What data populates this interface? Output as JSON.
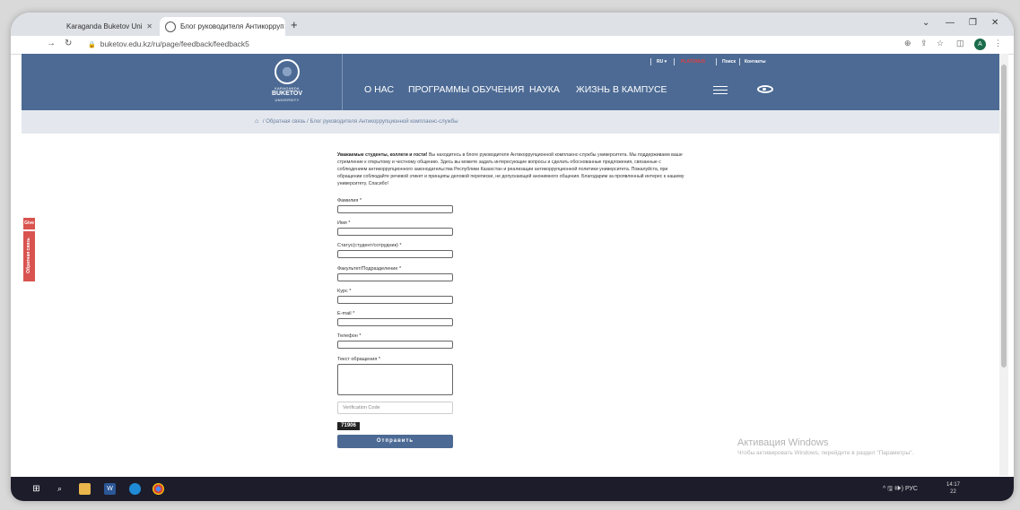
{
  "browser": {
    "tabs": [
      {
        "title": "Karaganda Buketov Uni",
        "close": "✕"
      },
      {
        "title": "Блог руководителя Антикорруп",
        "close": "✕"
      }
    ],
    "new_tab": "+",
    "window_controls": {
      "chevron": "⌄",
      "minimize": "—",
      "restore": "❐",
      "close": "✕"
    },
    "url": "buketov.edu.kz/ru/page/feedback/feedback5",
    "profile_initial": "A"
  },
  "site": {
    "logo": {
      "line1": "KARAGANDA",
      "line2": "BUKETOV",
      "line3": "UNIVERSITY"
    },
    "top_nav": {
      "lang": "RU ▾",
      "platonus": "PLATONUS",
      "search": "Поиск",
      "contacts": "Контакты"
    },
    "main_nav": [
      "О НАС",
      "ПРОГРАММЫ ОБУЧЕНИЯ",
      "НАУКА",
      "ЖИЗНЬ В КАМПУСЕ"
    ],
    "breadcrumb": {
      "home_icon": "⌂",
      "sep": "/",
      "item1": "Обратная связь",
      "item2": "Блог руководителя Антикоррупционной комплаенс-службы"
    }
  },
  "side": {
    "give": "Give",
    "feedback": "Обратная связь"
  },
  "form": {
    "intro_bold": "Уважаемые студенты, коллеги и гости!",
    "intro_text": "Вы находитесь в блоге руководителя Антикоррупционной комплаенс-службы университета. Мы поддерживаем ваше стремление к открытому и честному общению. Здесь вы можете задать интересующие вопросы и сделать обоснованные предложения, связанные с соблюдением антикоррупционного законодательства Республики Казахстан и реализации антикоррупционной политики университета. Пожалуйста, при обращении соблюдайте речевой этикет и принципы деловой переписки, не допускающей анонимного общения. Благодарим за проявленный интерес к нашему университету. Спасибо!",
    "fields": [
      "Фамилия *",
      "Имя *",
      "Статус(студент/сотрудник) *",
      "Факультет/Подразделение *",
      "Курс *",
      "E-mail *",
      "Телефон *"
    ],
    "message_label": "Текст обращения *",
    "verification_placeholder": "Verification Code",
    "captcha": "71906",
    "submit": "Отправить"
  },
  "os": {
    "watermark_title": "Активация Windows",
    "watermark_sub": "Чтобы активировать Windows, перейдите в раздел \"Параметры\".",
    "tray": "^ 🖫 🕪) РУС",
    "time": "14:17",
    "date": "22"
  }
}
